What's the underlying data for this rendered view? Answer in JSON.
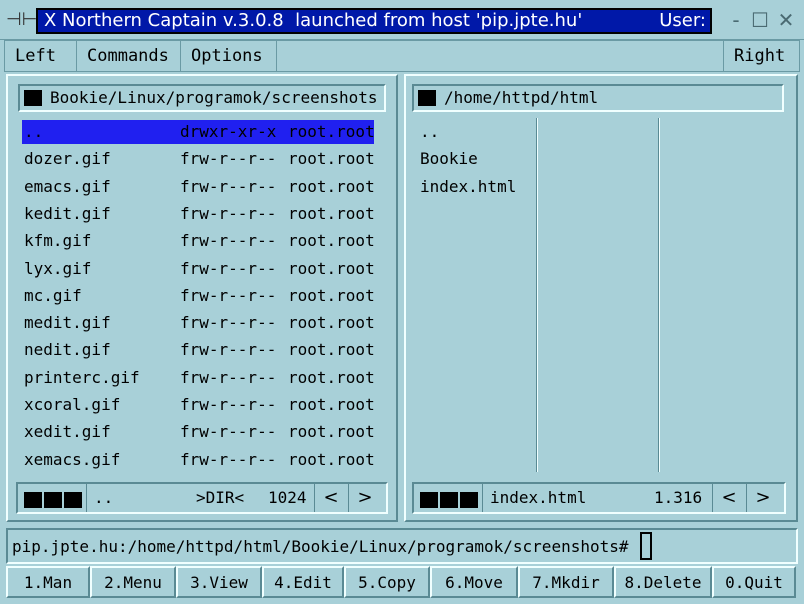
{
  "titlebar": {
    "menu_icon": "⊣⊢",
    "title": "X Northern Captain v.3.0.8  launched from host 'pip.jpte.hu'",
    "user_label": "User:",
    "minimize_icon": "-",
    "maximize_icon": "☐",
    "close_icon": "✕"
  },
  "menubar": {
    "left": "Left",
    "commands": "Commands",
    "options": "Options",
    "right": "Right"
  },
  "left_panel": {
    "path": "Bookie/Linux/programok/screenshots",
    "columns": [
      "name",
      "permissions",
      "owner"
    ],
    "files": [
      {
        "name": "..",
        "perms": "drwxr-xr-x",
        "owner": "root.root",
        "selected": true
      },
      {
        "name": "dozer.gif",
        "perms": "frw-r--r--",
        "owner": "root.root"
      },
      {
        "name": "emacs.gif",
        "perms": "frw-r--r--",
        "owner": "root.root"
      },
      {
        "name": "kedit.gif",
        "perms": "frw-r--r--",
        "owner": "root.root"
      },
      {
        "name": "kfm.gif",
        "perms": "frw-r--r--",
        "owner": "root.root"
      },
      {
        "name": "lyx.gif",
        "perms": "frw-r--r--",
        "owner": "root.root"
      },
      {
        "name": "mc.gif",
        "perms": "frw-r--r--",
        "owner": "root.root"
      },
      {
        "name": "medit.gif",
        "perms": "frw-r--r--",
        "owner": "root.root"
      },
      {
        "name": "nedit.gif",
        "perms": "frw-r--r--",
        "owner": "root.root"
      },
      {
        "name": "printerc.gif",
        "perms": "frw-r--r--",
        "owner": "root.root"
      },
      {
        "name": "xcoral.gif",
        "perms": "frw-r--r--",
        "owner": "root.root"
      },
      {
        "name": "xedit.gif",
        "perms": "frw-r--r--",
        "owner": "root.root"
      },
      {
        "name": "xemacs.gif",
        "perms": "frw-r--r--",
        "owner": "root.root"
      }
    ],
    "status": {
      "name": "..",
      "type": ">DIR<",
      "size": "1024",
      "prev_icon": "<",
      "next_icon": ">"
    }
  },
  "right_panel": {
    "path": "/home/httpd/html",
    "files": [
      "..",
      "Bookie",
      "index.html"
    ],
    "status": {
      "name": "index.html",
      "size": "1.316",
      "prev_icon": "<",
      "next_icon": ">"
    }
  },
  "command_line": {
    "prompt": "pip.jpte.hu:/home/httpd/html/Bookie/Linux/programok/screenshots#"
  },
  "function_keys": [
    "1.Man",
    "2.Menu",
    "3.View",
    "4.Edit",
    "5.Copy",
    "6.Move",
    "7.Mkdir",
    "8.Delete",
    "0.Quit"
  ],
  "colors": {
    "background": "#a8d0d8",
    "title_bg": "#0018a8",
    "selection": "#2020f0"
  }
}
